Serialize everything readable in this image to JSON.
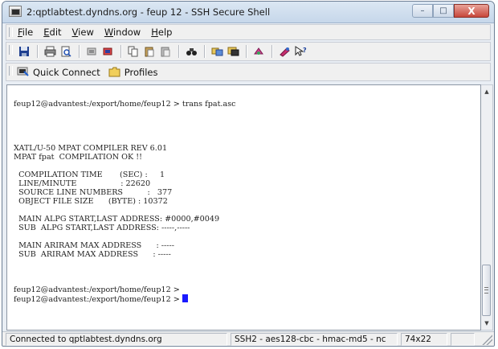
{
  "window": {
    "title": "2:qptlabtest.dyndns.org - feup 12 - SSH Secure Shell",
    "controls": {
      "minimize": "–",
      "maximize": "□",
      "close": "X"
    }
  },
  "menu": {
    "items": [
      "File",
      "Edit",
      "View",
      "Window",
      "Help"
    ]
  },
  "toolbar": {
    "icons": [
      "save-icon",
      "print-icon",
      "print-preview-icon",
      "disconnect-icon",
      "reconnect-icon",
      "copy-icon",
      "paste-icon",
      "paste-special-icon",
      "find-icon",
      "file-transfer-icon",
      "new-terminal-icon",
      "settings-icon",
      "encryption-icon",
      "help-icon"
    ]
  },
  "quickbar": {
    "quick_connect": "Quick Connect",
    "profiles": "Profiles"
  },
  "terminal": {
    "lines": [
      "feup12@advantest:/export/home/feup12 > trans fpat.asc",
      "",
      "",
      "",
      "",
      "XATL/U-50 MPAT COMPILER REV 6.01",
      "MPAT fpat  COMPILATION OK !!",
      "",
      "  COMPILATION TIME       (SEC) :     1",
      "  LINE/MINUTE                  : 22620",
      "  SOURCE LINE NUMBERS          :   377",
      "  OBJECT FILE SIZE      (BYTE) : 10372",
      "",
      "  MAIN ALPG START,LAST ADDRESS: #0000,#0049",
      "  SUB  ALPG START,LAST ADDRESS: -----,-----",
      "",
      "  MAIN ARIRAM MAX ADDRESS      : -----",
      "  SUB  ARIRAM MAX ADDRESS      : -----",
      "",
      "",
      "",
      "feup12@advantest:/export/home/feup12 >",
      "feup12@advantest:/export/home/feup12 > "
    ],
    "cursor_color": "#1a1aff"
  },
  "statusbar": {
    "connection": "Connected to qptlabtest.dyndns.org",
    "cipher": "SSH2 - aes128-cbc - hmac-md5 - nc",
    "size": "74x22"
  }
}
